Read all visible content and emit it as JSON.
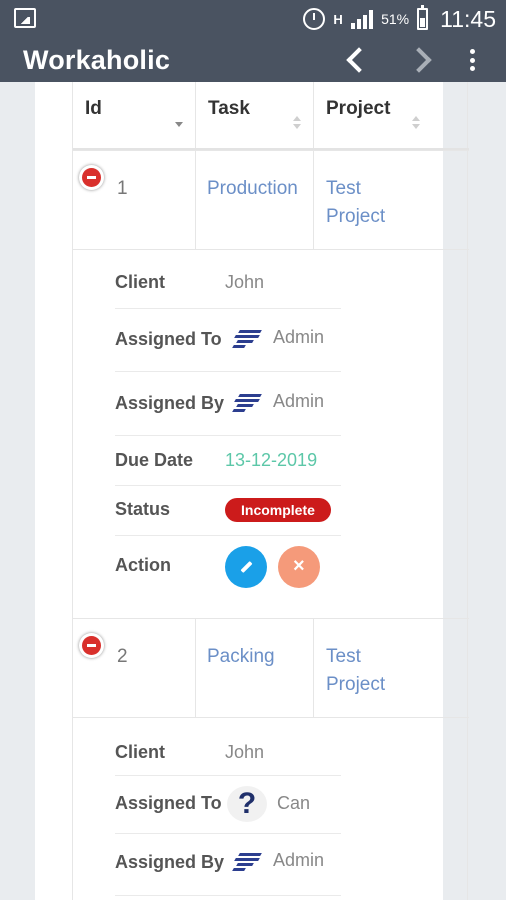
{
  "statusbar": {
    "network_type": "H",
    "battery_percent": "51%",
    "time": "11:45"
  },
  "appbar": {
    "title": "Workaholic"
  },
  "table": {
    "columns": [
      "Id",
      "Task",
      "Project"
    ],
    "detail_labels": {
      "client": "Client",
      "assigned_to": "Assigned To",
      "assigned_by": "Assigned By",
      "due_date": "Due Date",
      "status": "Status",
      "action": "Action"
    },
    "rows": [
      {
        "id": "1",
        "task": "Production",
        "project_line1": "Test",
        "project_line2": "Project",
        "client": "John",
        "assigned_to": "Admin",
        "assigned_to_icon": "company-logo-icon",
        "assigned_by": "Admin",
        "assigned_by_icon": "company-logo-icon",
        "due_date": "13-12-2019",
        "status": "Incomplete",
        "status_color": "#cc1b1b"
      },
      {
        "id": "2",
        "task": "Packing",
        "project_line1": "Test",
        "project_line2": "Project",
        "client": "John",
        "assigned_to": "Can",
        "assigned_to_icon": "question-avatar-icon",
        "assigned_by": "Admin",
        "assigned_by_icon": "company-logo-icon"
      }
    ]
  },
  "colors": {
    "toolbar": "#4a5361",
    "link": "#6b8fc7",
    "due_date": "#5cc7a8",
    "edit_button": "#1aa0e8",
    "delete_button": "#f59a7a"
  }
}
